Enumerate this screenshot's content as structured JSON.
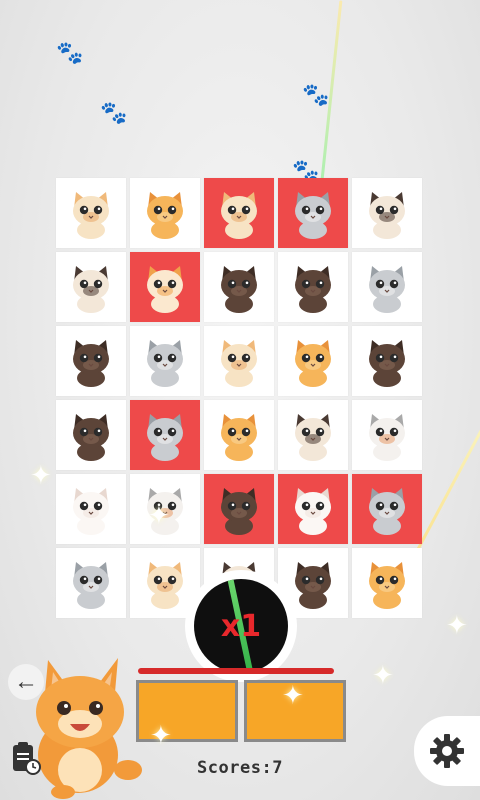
{
  "game": {
    "multiplier": "x1",
    "score_text": "Scores:7",
    "timer_progress": 0.95
  },
  "board": {
    "rows": [
      [
        {
          "cat": "cream-cat",
          "sel": false
        },
        {
          "cat": "orange-cat",
          "sel": false
        },
        {
          "cat": "cream-cat",
          "sel": true
        },
        {
          "cat": "gray-tabby-cat",
          "sel": true
        },
        {
          "cat": "siamese-cat",
          "sel": false
        }
      ],
      [
        {
          "cat": "siamese-cat",
          "sel": false
        },
        {
          "cat": "orange-white-cat",
          "sel": true
        },
        {
          "cat": "dark-brown-cat",
          "sel": false
        },
        {
          "cat": "dark-brown-cat",
          "sel": false
        },
        {
          "cat": "gray-tabby-cat",
          "sel": false
        }
      ],
      [
        {
          "cat": "dark-brown-cat",
          "sel": false
        },
        {
          "cat": "gray-tabby-cat",
          "sel": false
        },
        {
          "cat": "cream-cat",
          "sel": false
        },
        {
          "cat": "orange-cat",
          "sel": false
        },
        {
          "cat": "dark-brown-cat",
          "sel": false
        }
      ],
      [
        {
          "cat": "dark-brown-cat",
          "sel": false
        },
        {
          "cat": "gray-tabby-cat",
          "sel": true
        },
        {
          "cat": "orange-cat",
          "sel": false
        },
        {
          "cat": "siamese-cat",
          "sel": false
        },
        {
          "cat": "calico-cat",
          "sel": false
        }
      ],
      [
        {
          "cat": "white-cat",
          "sel": false
        },
        {
          "cat": "calico-cat",
          "sel": false
        },
        {
          "cat": "dark-brown-cat",
          "sel": true
        },
        {
          "cat": "white-cat",
          "sel": true
        },
        {
          "cat": "gray-tabby-cat",
          "sel": true
        }
      ],
      [
        {
          "cat": "gray-tabby-cat",
          "sel": false
        },
        {
          "cat": "cream-cat",
          "sel": false
        },
        {
          "cat": "siamese-cat",
          "sel": false
        },
        {
          "cat": "dark-brown-cat",
          "sel": false
        },
        {
          "cat": "orange-cat",
          "sel": false
        }
      ]
    ]
  },
  "palette": {
    "cream-cat": {
      "fur": "#f7e3c4",
      "ear": "#f0b97a",
      "mark": "#e9a868"
    },
    "orange-cat": {
      "fur": "#f6b55a",
      "ear": "#e8913a",
      "mark": "#f9d9a3"
    },
    "gray-tabby-cat": {
      "fur": "#c9ccd0",
      "ear": "#9aa0a6",
      "mark": "#f3f3f3"
    },
    "siamese-cat": {
      "fur": "#f3e7d8",
      "ear": "#4a3a33",
      "mark": "#4a3a33"
    },
    "dark-brown-cat": {
      "fur": "#5c4438",
      "ear": "#3e2d25",
      "mark": "#8a6b5a"
    },
    "orange-white-cat": {
      "fur": "#fbe8cf",
      "ear": "#f0a14a",
      "mark": "#f0a14a"
    },
    "white-cat": {
      "fur": "#fbf7f4",
      "ear": "#e8d8d0",
      "mark": "#f1e3dd"
    },
    "calico-cat": {
      "fur": "#f4f1ee",
      "ear": "#a9a9a9",
      "mark": "#e89b6a"
    }
  },
  "colors": {
    "selected": "#ee4a4a",
    "slot": "#f7a627",
    "multiplier": "#e8282c"
  },
  "icons": {
    "back": "back-arrow-icon",
    "settings": "gear-icon",
    "history": "clipboard-clock-icon"
  }
}
